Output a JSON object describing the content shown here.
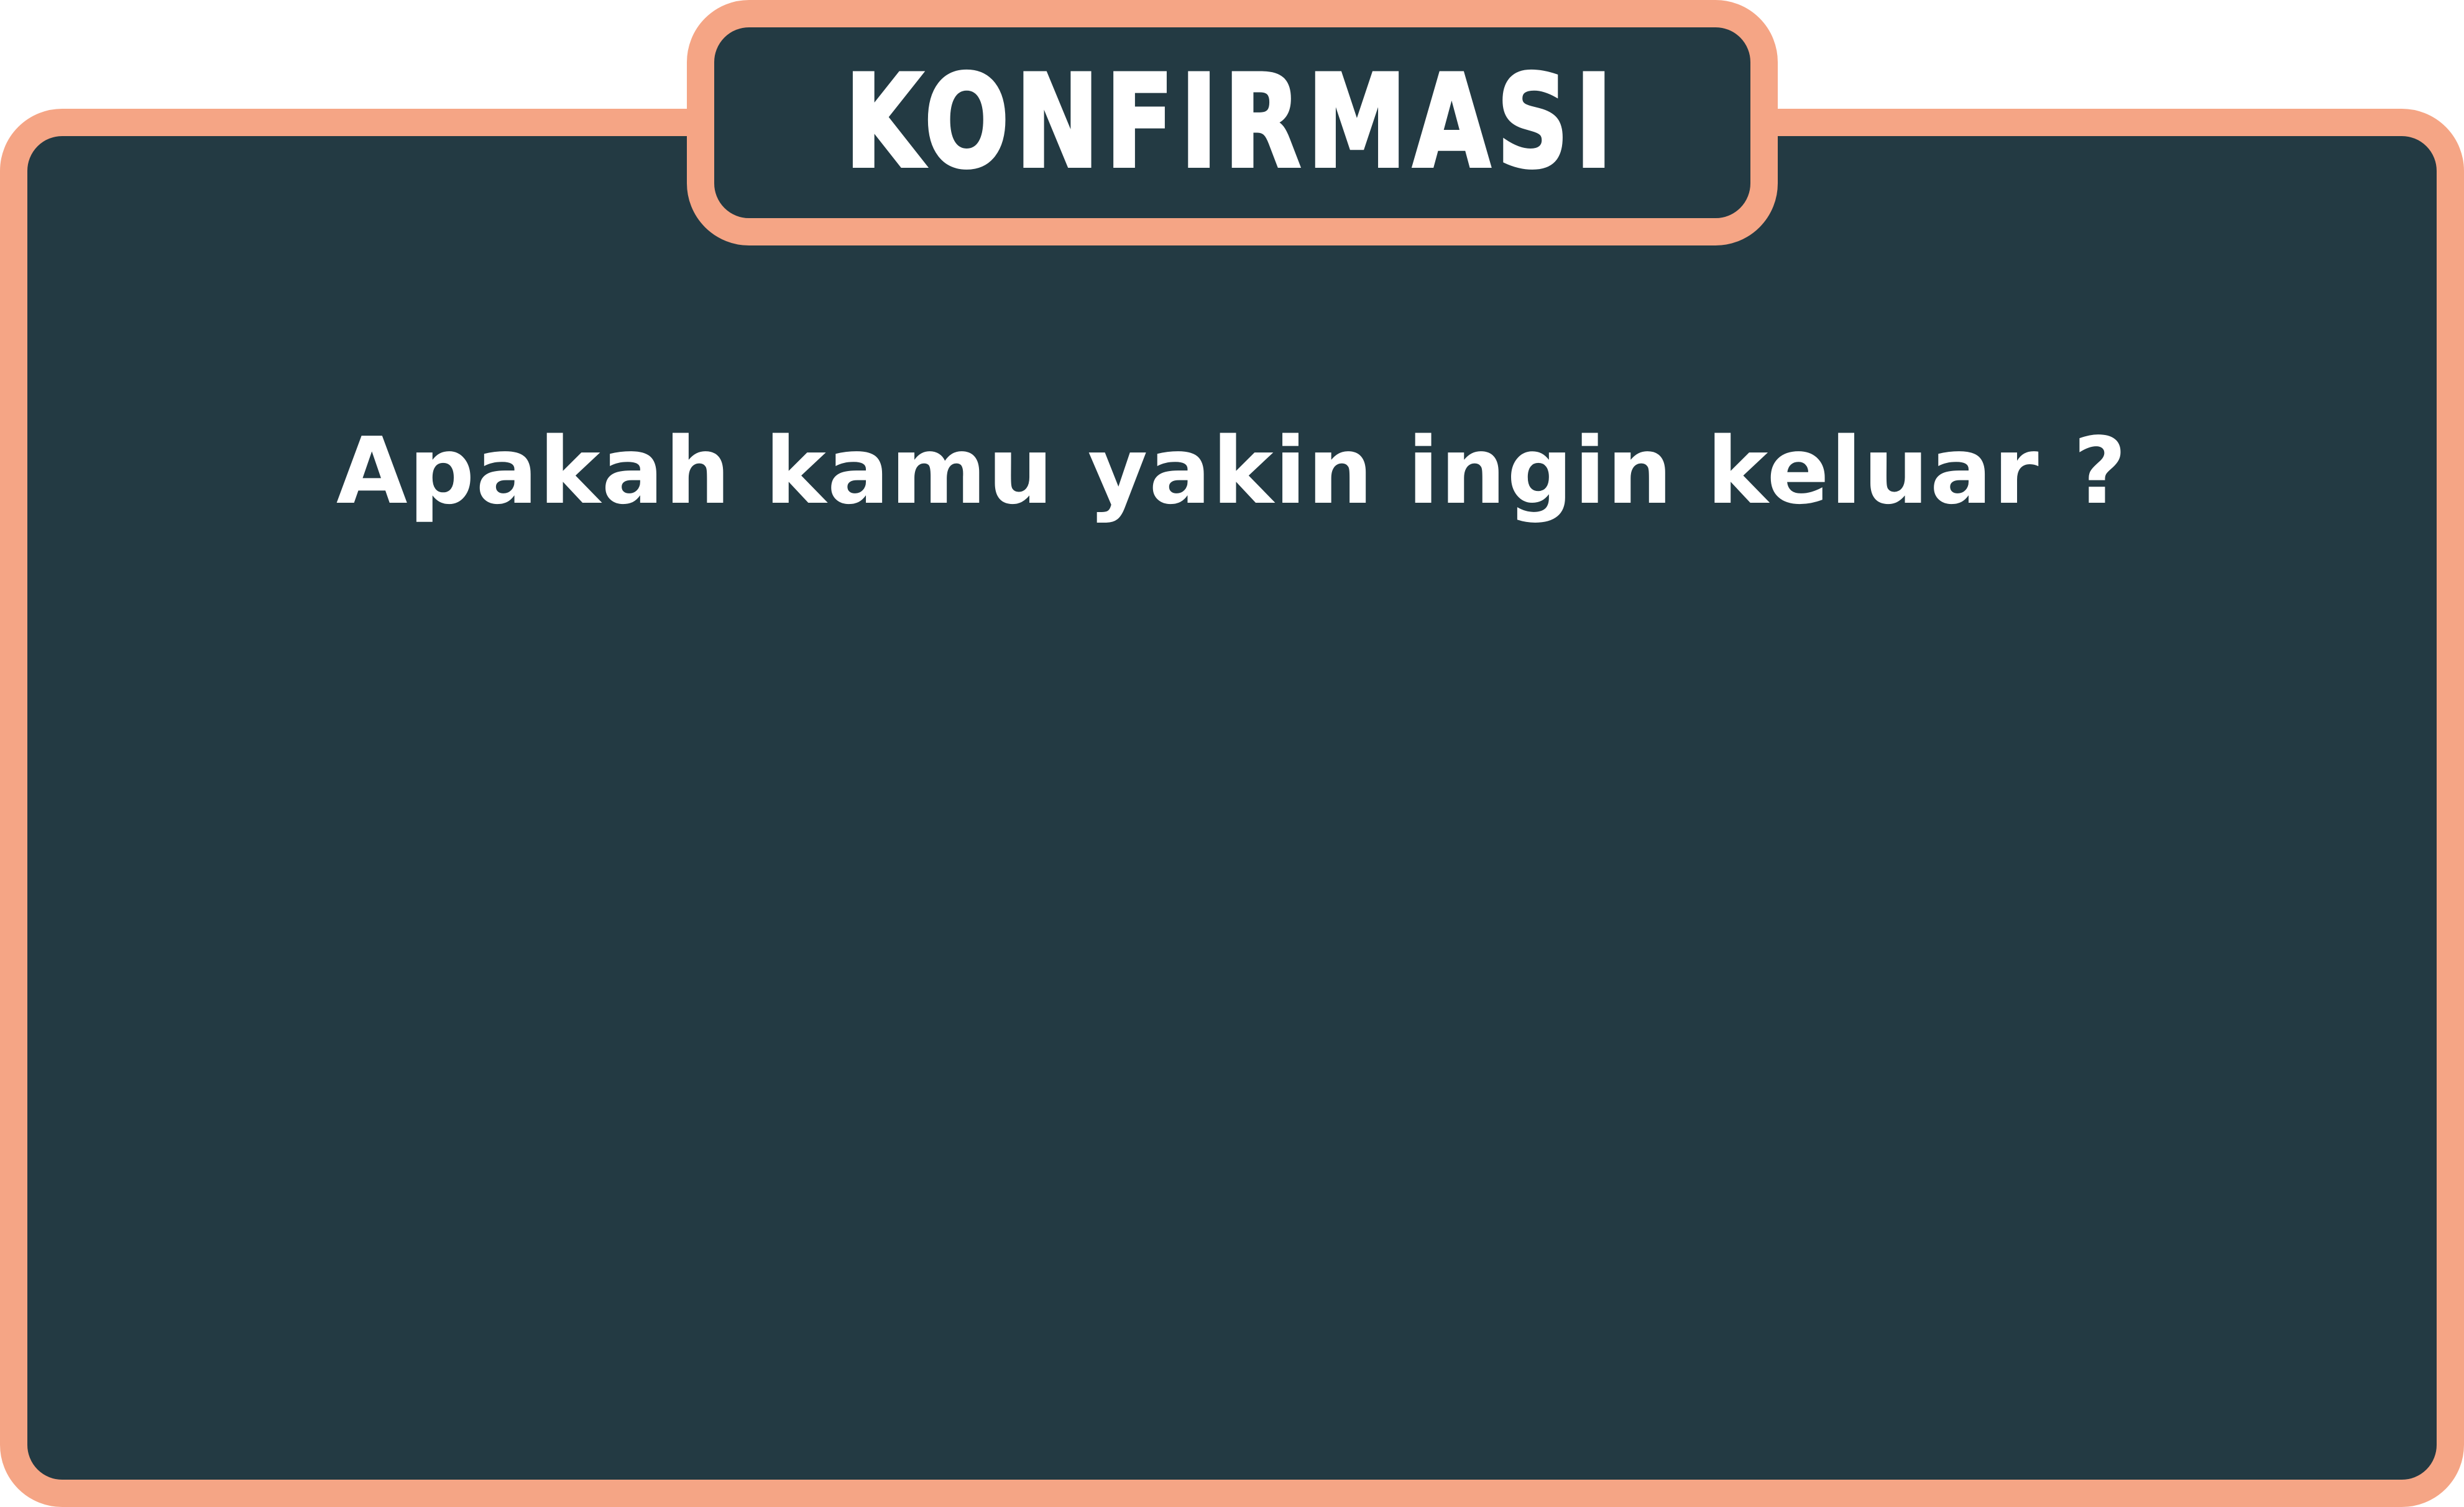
{
  "dialog": {
    "title": "KONFIRMASI",
    "message": "Apakah kamu yakin ingin keluar ?",
    "colors": {
      "background": "#233a43",
      "border": "#f5a585",
      "text": "#ffffff"
    }
  }
}
